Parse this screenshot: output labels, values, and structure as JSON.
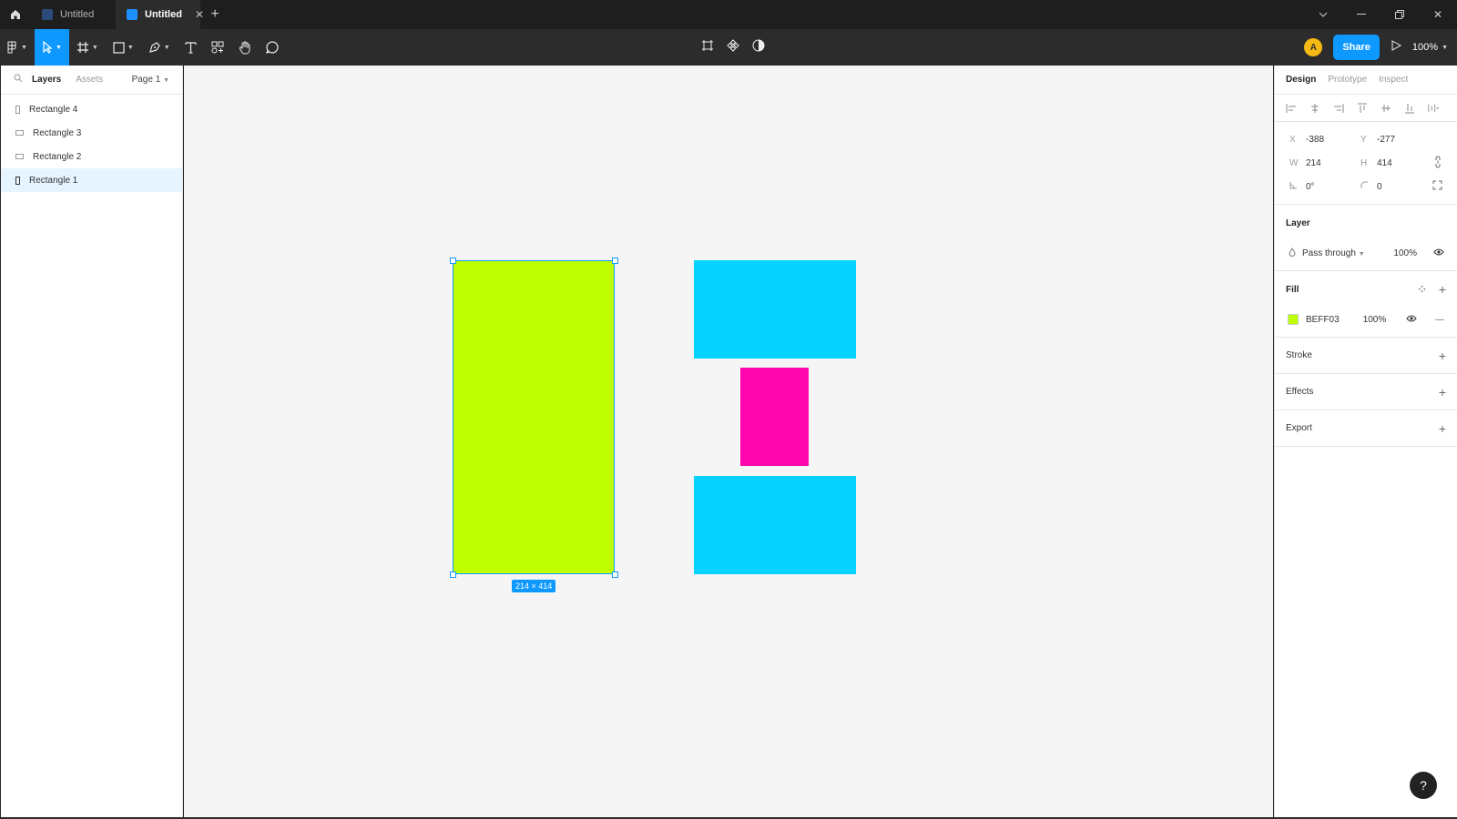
{
  "titlebar": {
    "tabs": [
      {
        "label": "Untitled",
        "active": false
      },
      {
        "label": "Untitled",
        "active": true
      }
    ]
  },
  "toolbar": {
    "avatar_initial": "A",
    "share_label": "Share",
    "zoom": "100%"
  },
  "left_panel": {
    "tab_layers": "Layers",
    "tab_assets": "Assets",
    "page": "Page 1",
    "layers": [
      {
        "label": "Rectangle 4",
        "selected": false
      },
      {
        "label": "Rectangle 3",
        "selected": false
      },
      {
        "label": "Rectangle 2",
        "selected": false
      },
      {
        "label": "Rectangle 1",
        "selected": true
      }
    ]
  },
  "canvas": {
    "shapes": [
      {
        "name": "Rectangle 1",
        "color": "#BEFF03",
        "selected": true
      },
      {
        "name": "Rectangle 2",
        "color": "#08D2FF"
      },
      {
        "name": "Rectangle 3",
        "color": "#FF05AE"
      },
      {
        "name": "Rectangle 4",
        "color": "#08D2FF"
      }
    ],
    "size_label": "214 × 414"
  },
  "right_panel": {
    "tabs": [
      "Design",
      "Prototype",
      "Inspect"
    ],
    "x_label": "X",
    "x_value": "-388",
    "y_label": "Y",
    "y_value": "-277",
    "w_label": "W",
    "w_value": "214",
    "h_label": "H",
    "h_value": "414",
    "rotation": "0°",
    "radius": "0",
    "layer_title": "Layer",
    "blend_mode": "Pass through",
    "layer_opacity": "100%",
    "fill_title": "Fill",
    "fill_hex": "BEFF03",
    "fill_opacity": "100%",
    "stroke_title": "Stroke",
    "effects_title": "Effects",
    "export_title": "Export"
  },
  "help_label": "?"
}
